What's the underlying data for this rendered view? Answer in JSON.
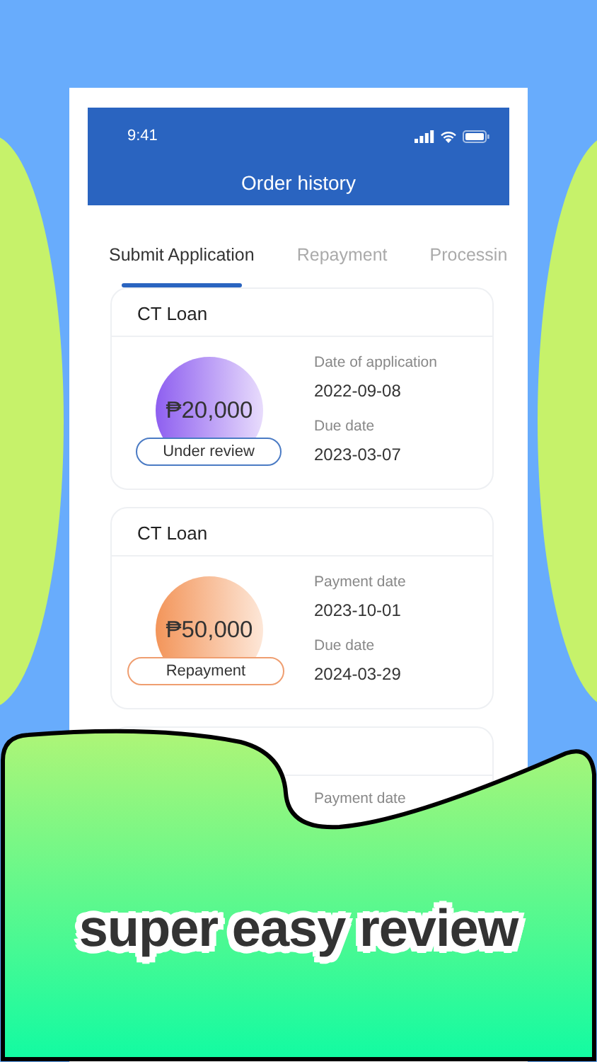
{
  "status_bar": {
    "time": "9:41"
  },
  "header": {
    "title": "Order history"
  },
  "tabs": [
    {
      "label": "Submit Application",
      "selected": true
    },
    {
      "label": "Repayment",
      "selected": false
    },
    {
      "label": "Processin",
      "selected": false
    }
  ],
  "orders": [
    {
      "kind": "review",
      "name": "CT Loan",
      "amount": "₱20,000",
      "status": "Under review",
      "fields": [
        {
          "label": "Date of application",
          "value": "2022-09-08"
        },
        {
          "label": "Due date",
          "value": "2023-03-07"
        }
      ]
    },
    {
      "kind": "repayment",
      "name": "CT Loan",
      "amount": "₱50,000",
      "status": "Repayment",
      "fields": [
        {
          "label": "Payment date",
          "value": "2023-10-01"
        },
        {
          "label": "Due date",
          "value": "2024-03-29"
        }
      ]
    },
    {
      "kind": "partial",
      "fields": [
        {
          "label": "Payment date"
        }
      ]
    }
  ],
  "banner": {
    "text": "super easy review"
  }
}
